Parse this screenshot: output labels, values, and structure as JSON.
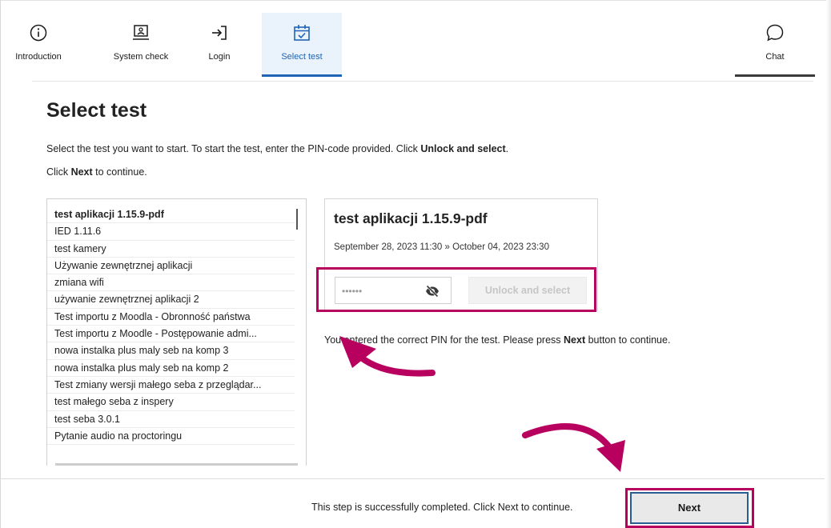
{
  "nav": {
    "items": [
      {
        "label": "Introduction",
        "icon": "info-icon"
      },
      {
        "label": "System check",
        "icon": "laptop-check-icon"
      },
      {
        "label": "Login",
        "icon": "login-icon"
      },
      {
        "label": "Select test",
        "icon": "calendar-check-icon",
        "active": true
      }
    ],
    "chat": {
      "label": "Chat",
      "icon": "chat-bubble-icon"
    }
  },
  "page": {
    "title": "Select test",
    "intro_before": "Select the test you want to start. To start the test, enter the PIN-code provided. Click ",
    "intro_bold": "Unlock and select",
    "intro_after": ".",
    "next_before": "Click ",
    "next_bold": "Next",
    "next_after": " to continue."
  },
  "tests": [
    "test aplikacji 1.15.9-pdf",
    "IED 1.11.6",
    "test kamery",
    "Używanie zewnętrznej aplikacji",
    "zmiana wifi",
    "używanie zewnętrznej aplikacji 2",
    "Test importu z Moodla - Obronność państwa",
    "Test importu z Moodle - Postępowanie admi...",
    "nowa instalka plus maly seb na komp 3",
    "nowa instalka plus maly seb na komp 2",
    "Test zmiany wersji małego seba z przeglądar...",
    "test małego seba z inspery",
    "test seba 3.0.1",
    "Pytanie audio na proctoringu"
  ],
  "detail": {
    "title": "test aplikacji 1.15.9-pdf",
    "dates": "September 28, 2023 11:30 » October 04, 2023 23:30",
    "pin_value": "••••••",
    "unlock_label": "Unlock and select"
  },
  "status": {
    "before": "You entered the correct PIN for the test. Please press ",
    "bold": "Next",
    "after": " button to continue."
  },
  "footer": {
    "message": "This step is successfully completed. Click Next to continue.",
    "next_label": "Next"
  },
  "colors": {
    "accent": "#1f64b5",
    "highlight": "#b8005f",
    "active_tab_bg": "#eaf2fb"
  }
}
